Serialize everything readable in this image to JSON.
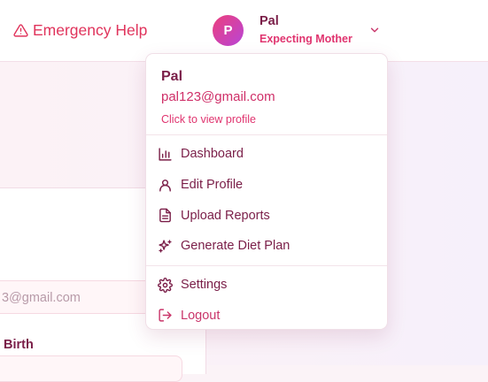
{
  "header": {
    "emergency_label": "Emergency Help",
    "user": {
      "avatar_initial": "P",
      "name": "Pal",
      "role": "Expecting Mother"
    }
  },
  "dropdown": {
    "name": "Pal",
    "email": "pal123@gmail.com",
    "profile_link": "Click to view profile",
    "menu_items": [
      {
        "label": "Dashboard",
        "icon": "bar-chart-icon"
      },
      {
        "label": "Edit Profile",
        "icon": "user-icon"
      },
      {
        "label": "Upload Reports",
        "icon": "document-icon"
      },
      {
        "label": "Generate Diet Plan",
        "icon": "sparkles-icon"
      }
    ],
    "footer_items": [
      {
        "label": "Settings",
        "icon": "gear-icon"
      },
      {
        "label": "Logout",
        "icon": "logout-icon"
      }
    ]
  },
  "background_form": {
    "email_value": "3@gmail.com",
    "birth_label": "Birth"
  },
  "colors": {
    "accent": "#e0346f",
    "text_primary": "#7a1e48",
    "emergency": "#e0345c",
    "avatar_gradient_start": "#ec3f7c",
    "avatar_gradient_end": "#b845d8"
  }
}
